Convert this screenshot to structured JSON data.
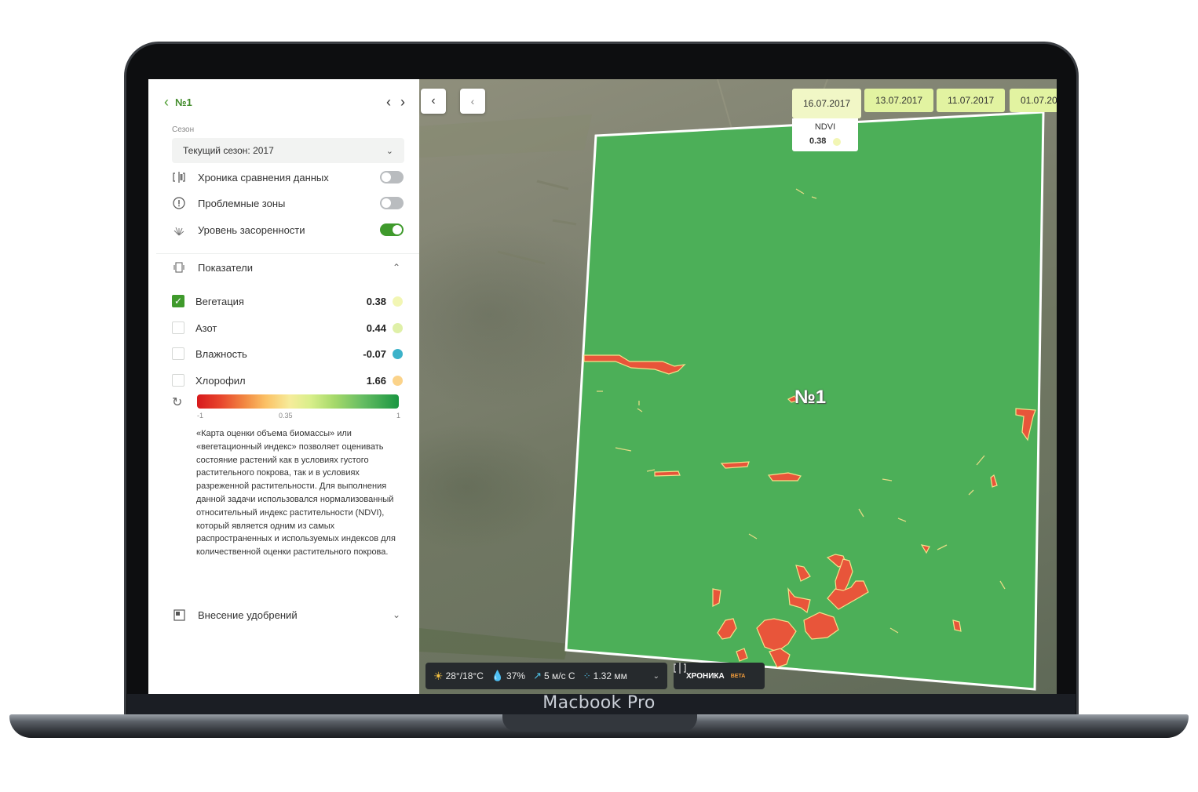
{
  "device_label": "Macbook Pro",
  "sidebar": {
    "back_icon": "chevron-left-icon",
    "title": "№1",
    "season_label": "Сезон",
    "season_value": "Текущий сезон: 2017",
    "toggles": [
      {
        "label": "Хроника сравнения данных",
        "icon": "compare-icon",
        "on": false
      },
      {
        "label": "Проблемные зоны",
        "icon": "alert-icon",
        "on": false
      },
      {
        "label": "Уровень засоренности",
        "icon": "weed-icon",
        "on": true
      }
    ],
    "indicators_section": "Показатели",
    "indicators": [
      {
        "label": "Вегетация",
        "value": "0.38",
        "checked": true,
        "color": "#f2f6b4"
      },
      {
        "label": "Азот",
        "value": "0.44",
        "checked": false,
        "color": "#dff0a8"
      },
      {
        "label": "Влажность",
        "value": "-0.07",
        "checked": false,
        "color": "#3cb2c9"
      },
      {
        "label": "Хлорофил",
        "value": "1.66",
        "checked": false,
        "color": "#fbd38a"
      }
    ],
    "scale_ticks": [
      "-1",
      "0.35",
      "1"
    ],
    "description": "«Карта оценки объема биомассы» или «вегетационный индекс» позволяет оценивать состояние растений как в условиях густого растительного покрова, так и в условиях разреженной растительности. Для выполнения данной задачи использовался нормализованный относительный индекс растительности (NDVI), который является одним из самых распространенных и используемых индексов для количественной оценки растительного покрова.",
    "fertilizer_section": "Внесение удобрений"
  },
  "map": {
    "dates": [
      "16.07.2017",
      "13.07.2017",
      "11.07.2017",
      "01.07.20"
    ],
    "popup_label": "NDVI",
    "popup_value": "0.38",
    "field_label": "№1",
    "field_color": "#4caf58",
    "problem_color": "#e8553a",
    "weather": {
      "temp": "28°/18°C",
      "humidity": "37%",
      "wind": "5 м/с С",
      "rain": "1.32 мм"
    },
    "chronicle_label": "ХРОНИКА",
    "chronicle_badge": "BETA"
  }
}
